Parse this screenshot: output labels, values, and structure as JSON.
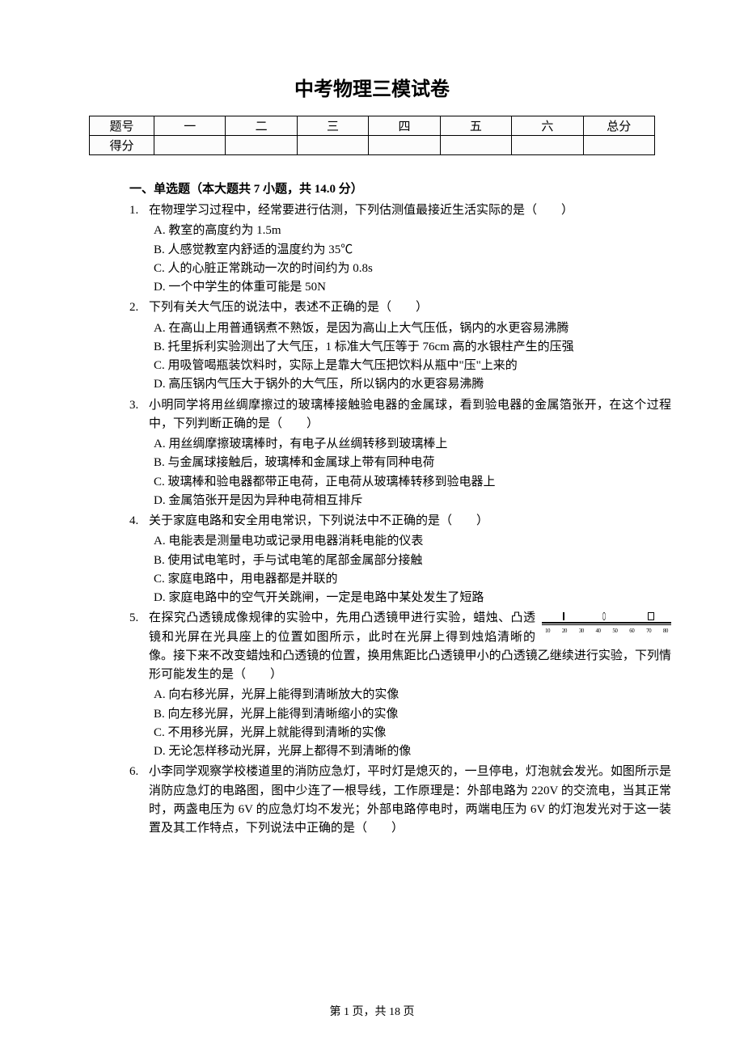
{
  "title": "中考物理三模试卷",
  "score_table": {
    "row_label": "题号",
    "cols": [
      "一",
      "二",
      "三",
      "四",
      "五",
      "六",
      "总分"
    ],
    "score_label": "得分"
  },
  "section1": {
    "header": "一、单选题（本大题共 7 小题，共 14.0 分）",
    "questions": [
      {
        "num": "1.",
        "stem": "在物理学习过程中，经常要进行估测，下列估测值最接近生活实际的是（　　）",
        "opts": [
          "A. 教室的高度约为 1.5m",
          "B. 人感觉教室内舒适的温度约为 35℃",
          "C. 人的心脏正常跳动一次的时间约为 0.8s",
          "D. 一个中学生的体重可能是 50N"
        ]
      },
      {
        "num": "2.",
        "stem": "下列有关大气压的说法中，表述不正确的是（　　）",
        "opts": [
          "A. 在高山上用普通锅煮不熟饭，是因为高山上大气压低，锅内的水更容易沸腾",
          "B. 托里拆利实验测出了大气压，1 标准大气压等于 76cm 高的水银柱产生的压强",
          "C. 用吸管喝瓶装饮料时，实际上是靠大气压把饮料从瓶中\"压\"上来的",
          "D. 高压锅内气压大于锅外的大气压，所以锅内的水更容易沸腾"
        ]
      },
      {
        "num": "3.",
        "stem": "小明同学将用丝绸摩擦过的玻璃棒接触验电器的金属球，看到验电器的金属箔张开，在这个过程中，下列判断正确的是（　　）",
        "opts": [
          "A. 用丝绸摩擦玻璃棒时，有电子从丝绸转移到玻璃棒上",
          "B. 与金属球接触后，玻璃棒和金属球上带有同种电荷",
          "C. 玻璃棒和验电器都带正电荷，正电荷从玻璃棒转移到验电器上",
          "D. 金属箔张开是因为异种电荷相互排斥"
        ]
      },
      {
        "num": "4.",
        "stem": "关于家庭电路和安全用电常识，下列说法中不正确的是（　　）",
        "opts": [
          "A. 电能表是测量电功或记录用电器消耗电能的仪表",
          "B. 使用试电笔时，手与试电笔的尾部金属部分接触",
          "C. 家庭电路中，用电器都是并联的",
          "D. 家庭电路中的空气开关跳闸，一定是电路中某处发生了短路"
        ]
      },
      {
        "num": "5.",
        "stem": "在探究凸透镜成像规律的实验中，先用凸透镜甲进行实验，蜡烛、凸透镜和光屏在光具座上的位置如图所示，此时在光屏上得到烛焰清晰的像。接下来不改变蜡烛和凸透镜的位置，换用焦距比凸透镜甲小的凸透镜乙继续进行实验，下列情形可能发生的是（　　）",
        "opts": [
          "A. 向右移光屏，光屏上能得到清晰放大的实像",
          "B. 向左移光屏，光屏上能得到清晰缩小的实像",
          "C. 不用移光屏，光屏上就能得到清晰的实像",
          "D. 无论怎样移动光屏，光屏上都得不到清晰的像"
        ],
        "has_image": true,
        "ruler": [
          "10",
          "20",
          "30",
          "40",
          "50",
          "60",
          "70",
          "80"
        ]
      },
      {
        "num": "6.",
        "stem": "小李同学观察学校楼道里的消防应急灯，平时灯是熄灭的，一旦停电，灯泡就会发光。如图所示是消防应急灯的电路图，图中少连了一根导线，工作原理是：外部电路为 220V 的交流电，当其正常时，两盏电压为 6V 的应急灯均不发光；外部电路停电时，两端电压为 6V 的灯泡发光对于这一装置及其工作特点，下列说法中正确的是（　　）",
        "opts": []
      }
    ]
  },
  "footer": "第 1 页，共 18 页"
}
